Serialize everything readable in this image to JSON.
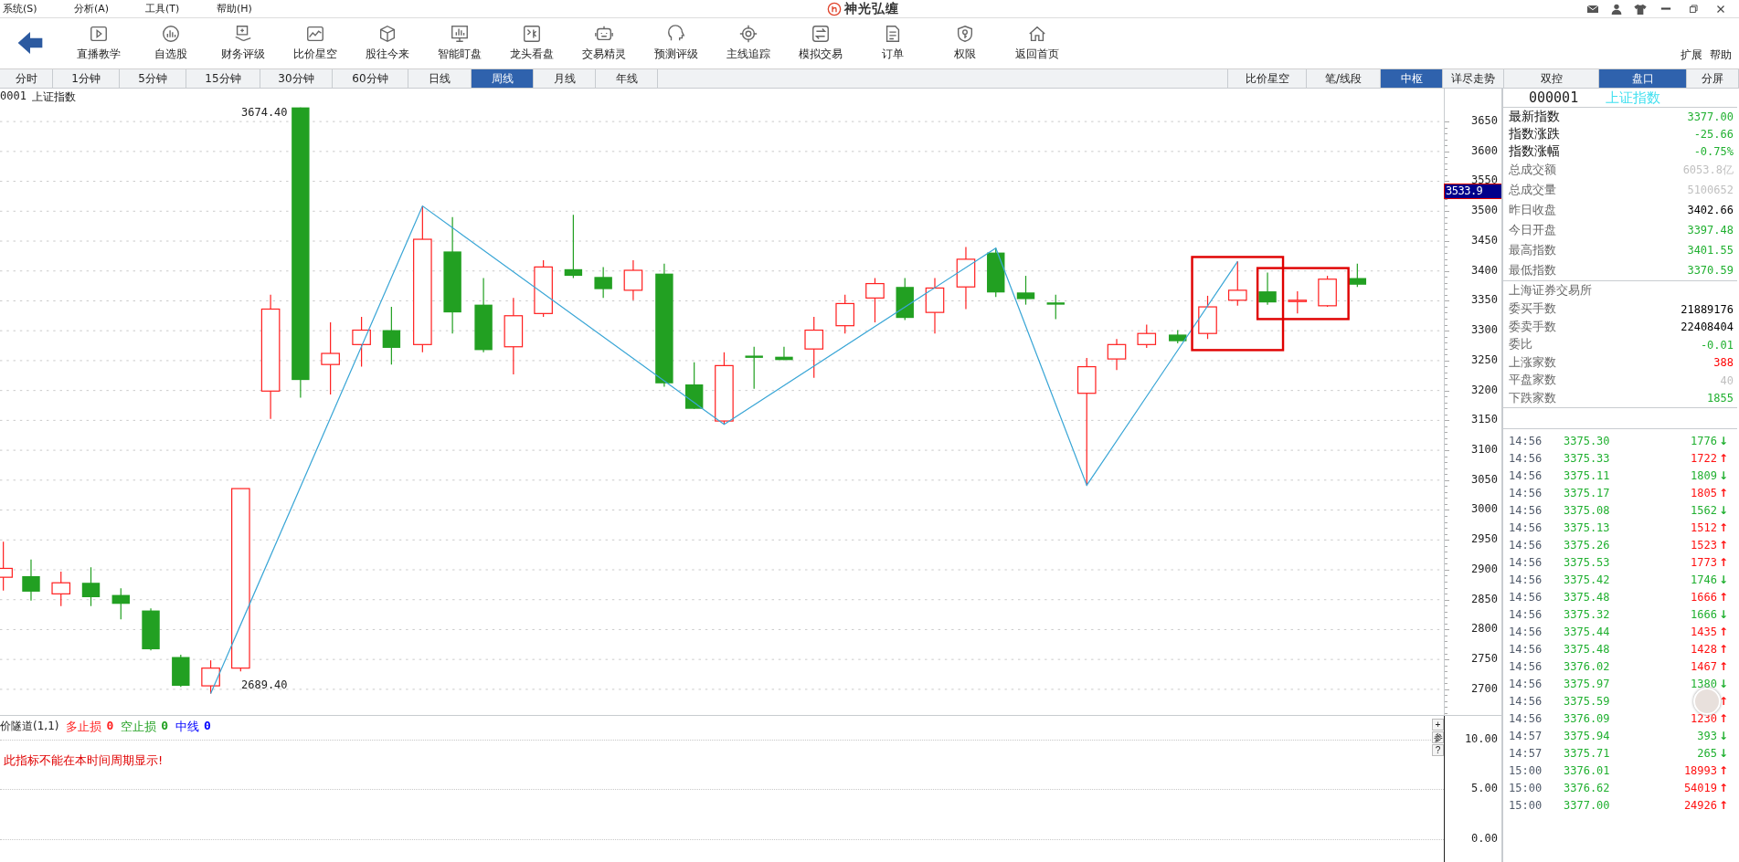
{
  "menu": [
    {
      "label": "系统(S)"
    },
    {
      "label": "分析(A)"
    },
    {
      "label": "工具(T)"
    },
    {
      "label": "帮助(H)"
    }
  ],
  "app_title": "神光弘缠",
  "toolbar": {
    "items": [
      "直播教学",
      "自选股",
      "财务评级",
      "比价星空",
      "股往今来",
      "智能盯盘",
      "龙头看盘",
      "交易精灵",
      "预测评级",
      "主线追踪",
      "模拟交易",
      "订单",
      "权限",
      "返回首页"
    ],
    "extra": [
      "扩展",
      "帮助"
    ]
  },
  "period_tabs": [
    {
      "label": "分时",
      "selected": false
    },
    {
      "label": "1分钟",
      "selected": false
    },
    {
      "label": "5分钟",
      "selected": false
    },
    {
      "label": "15分钟",
      "selected": false
    },
    {
      "label": "30分钟",
      "selected": false
    },
    {
      "label": "60分钟",
      "selected": false
    },
    {
      "label": "日线",
      "selected": false
    },
    {
      "label": "周线",
      "selected": true
    },
    {
      "label": "月线",
      "selected": false
    },
    {
      "label": "年线",
      "selected": false
    }
  ],
  "view_tabs": [
    {
      "label": "比价星空",
      "selected": false
    },
    {
      "label": "笔/线段",
      "selected": false
    },
    {
      "label": "中枢",
      "selected": true
    },
    {
      "label": "详尽走势",
      "selected": false
    }
  ],
  "panel_tabs": [
    {
      "label": "双控",
      "selected": false
    },
    {
      "label": "盘口",
      "selected": true
    },
    {
      "label": "分屏",
      "selected": false
    }
  ],
  "chart": {
    "code": "0001",
    "name": "上证指数",
    "yticks": [
      "3650",
      "3600",
      "3550",
      "3500",
      "3450",
      "3400",
      "3350",
      "3300",
      "3250",
      "3200",
      "3150",
      "3100",
      "3050",
      "3000",
      "2950",
      "2900",
      "2850",
      "2800",
      "2750",
      "2700"
    ],
    "high_label": "3674.40",
    "low_label": "2689.40",
    "price_marker": "3533.9"
  },
  "indicator": {
    "name": "价隧道(1,1)",
    "legend": [
      {
        "label": "多止损",
        "value": "0",
        "color": "#ff2020"
      },
      {
        "label": "空止损",
        "value": "0",
        "color": "#20a020"
      },
      {
        "label": "中线",
        "value": "0",
        "color": "#0000ff"
      }
    ],
    "message": "此指标不能在本时间周期显示!",
    "yticks": [
      "10.00",
      "5.00",
      "0.00"
    ],
    "side_buttons": [
      "+",
      "参",
      "?"
    ]
  },
  "quote": {
    "code": "000001",
    "name": "上证指数",
    "fields": [
      {
        "label": "最新指数",
        "value": "3377.00",
        "kind": "main",
        "color": "#20b030"
      },
      {
        "label": "指数涨跌",
        "value": "-25.66",
        "kind": "main",
        "color": "#20b030"
      },
      {
        "label": "指数涨幅",
        "value": "-0.75%",
        "kind": "main",
        "color": "#20b030"
      },
      {
        "label": "总成交额",
        "value": "6053.8亿",
        "kind": "normal",
        "color": "#c0c0c0"
      },
      {
        "label": "总成交量",
        "value": "5100652",
        "kind": "normal",
        "color": "#c0c0c0"
      },
      {
        "label": "昨日收盘",
        "value": "3402.66",
        "kind": "normal",
        "color": "#000000"
      },
      {
        "label": "今日开盘",
        "value": "3397.48",
        "kind": "normal",
        "color": "#20b030"
      },
      {
        "label": "最高指数",
        "value": "3401.55",
        "kind": "normal",
        "color": "#20b030"
      },
      {
        "label": "最低指数",
        "value": "3370.59",
        "kind": "normal",
        "color": "#20b030"
      }
    ],
    "exchange": "上海证券交易所",
    "fields2": [
      {
        "label": "委买手数",
        "value": "21889176",
        "kind": "normal",
        "color": "#000000"
      },
      {
        "label": "委卖手数",
        "value": "22408404",
        "kind": "normal",
        "color": "#000000"
      },
      {
        "label": "委比",
        "value": "-0.01",
        "kind": "normal",
        "color": "#20b030"
      },
      {
        "label": "上涨家数",
        "value": "388",
        "kind": "normal",
        "color": "#ff0000"
      },
      {
        "label": "平盘家数",
        "value": "40",
        "kind": "normal",
        "color": "#c0c0c0"
      },
      {
        "label": "下跌家数",
        "value": "1855",
        "kind": "normal",
        "color": "#20b030"
      }
    ],
    "trades": [
      {
        "time": "14:56",
        "price": "3375.30",
        "volume": "1776",
        "arrow": "↓",
        "color": "#20b030"
      },
      {
        "time": "14:56",
        "price": "3375.33",
        "volume": "1722",
        "arrow": "↑",
        "color": "#ff1010"
      },
      {
        "time": "14:56",
        "price": "3375.11",
        "volume": "1809",
        "arrow": "↓",
        "color": "#20b030"
      },
      {
        "time": "14:56",
        "price": "3375.17",
        "volume": "1805",
        "arrow": "↑",
        "color": "#ff1010"
      },
      {
        "time": "14:56",
        "price": "3375.08",
        "volume": "1562",
        "arrow": "↓",
        "color": "#20b030"
      },
      {
        "time": "14:56",
        "price": "3375.13",
        "volume": "1512",
        "arrow": "↑",
        "color": "#ff1010"
      },
      {
        "time": "14:56",
        "price": "3375.26",
        "volume": "1523",
        "arrow": "↑",
        "color": "#ff1010"
      },
      {
        "time": "14:56",
        "price": "3375.53",
        "volume": "1773",
        "arrow": "↑",
        "color": "#ff1010"
      },
      {
        "time": "14:56",
        "price": "3375.42",
        "volume": "1746",
        "arrow": "↓",
        "color": "#20b030"
      },
      {
        "time": "14:56",
        "price": "3375.48",
        "volume": "1666",
        "arrow": "↑",
        "color": "#ff1010"
      },
      {
        "time": "14:56",
        "price": "3375.32",
        "volume": "1666",
        "arrow": "↓",
        "color": "#20b030"
      },
      {
        "time": "14:56",
        "price": "3375.44",
        "volume": "1435",
        "arrow": "↑",
        "color": "#ff1010"
      },
      {
        "time": "14:56",
        "price": "3375.48",
        "volume": "1428",
        "arrow": "↑",
        "color": "#ff1010"
      },
      {
        "time": "14:56",
        "price": "3376.02",
        "volume": "1467",
        "arrow": "↑",
        "color": "#ff1010"
      },
      {
        "time": "14:56",
        "price": "3375.97",
        "volume": "1380",
        "arrow": "↓",
        "color": "#20b030"
      },
      {
        "time": "14:56",
        "price": "3375.59",
        "arrow": "↑",
        "color": "#ff1010"
      },
      {
        "time": "14:56",
        "price": "3376.09",
        "volume": "1230",
        "arrow": "↑",
        "color": "#ff1010"
      },
      {
        "time": "14:57",
        "price": "3375.94",
        "volume": "393",
        "arrow": "↓",
        "color": "#20b030"
      },
      {
        "time": "14:57",
        "price": "3375.71",
        "volume": "265",
        "arrow": "↓",
        "color": "#20b030"
      },
      {
        "time": "15:00",
        "price": "3376.01",
        "volume": "18993",
        "arrow": "↑",
        "color": "#ff1010"
      },
      {
        "time": "15:00",
        "price": "3376.62",
        "volume": "54019",
        "arrow": "↑",
        "color": "#ff1010"
      },
      {
        "time": "15:00",
        "price": "3377.00",
        "volume": "24926",
        "arrow": "↑",
        "color": "#ff1010"
      }
    ]
  }
}
